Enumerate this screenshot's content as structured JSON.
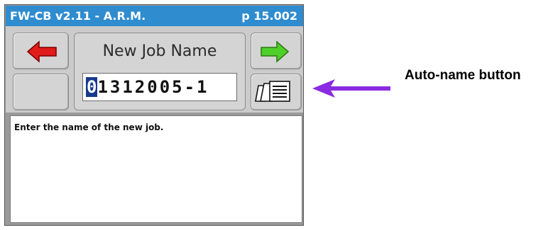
{
  "window": {
    "title": "FW-CB v2.11 - A.R.M.",
    "page_number": "p 15.002"
  },
  "screen": {
    "title": "New Job Name",
    "job_name_cursor_char": "0",
    "job_name_rest": "1312005-1",
    "message": "Enter the name of the new job."
  },
  "buttons": {
    "back_icon": "red-left-arrow-icon",
    "next_icon": "green-right-arrow-icon",
    "auto_name_icon": "document-stack-icon"
  },
  "annotation": {
    "label": "Auto-name button",
    "arrow_color": "#8a2be2"
  },
  "colors": {
    "titlebar": "#2f8ccf",
    "back_arrow": "#e21b1b",
    "next_arrow": "#4fcf2a",
    "cursor_highlight": "#163a8c"
  }
}
